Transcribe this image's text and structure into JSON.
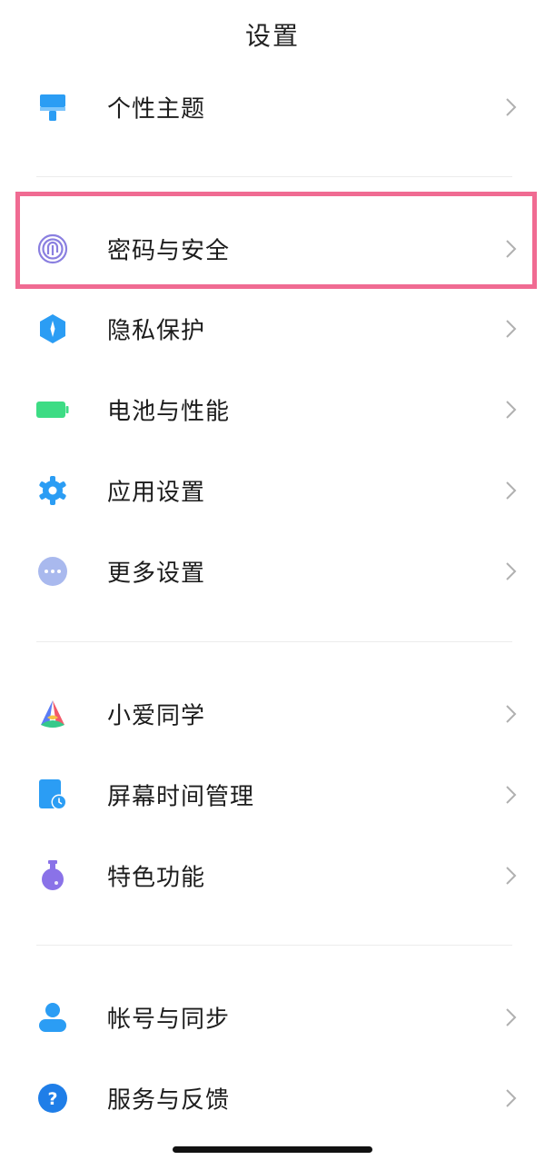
{
  "page": {
    "title": "设置"
  },
  "items": [
    {
      "key": "theme",
      "label": "个性主题",
      "icon": "paint-brush-icon"
    },
    {
      "key": "password",
      "label": "密码与安全",
      "icon": "fingerprint-icon"
    },
    {
      "key": "privacy",
      "label": "隐私保护",
      "icon": "privacy-shield-icon"
    },
    {
      "key": "battery",
      "label": "电池与性能",
      "icon": "battery-icon"
    },
    {
      "key": "apps",
      "label": "应用设置",
      "icon": "gear-icon"
    },
    {
      "key": "more",
      "label": "更多设置",
      "icon": "more-dots-icon"
    },
    {
      "key": "xiaoai",
      "label": "小爱同学",
      "icon": "xiaoai-icon"
    },
    {
      "key": "screentime",
      "label": "屏幕时间管理",
      "icon": "screen-time-icon"
    },
    {
      "key": "features",
      "label": "特色功能",
      "icon": "flask-icon"
    },
    {
      "key": "account",
      "label": "帐号与同步",
      "icon": "account-person-icon"
    },
    {
      "key": "feedback",
      "label": "服务与反馈",
      "icon": "help-question-icon"
    }
  ],
  "colors": {
    "highlight": "#f06b92",
    "blue": "#2196f3",
    "green": "#3ddc84",
    "purple": "#8a72e8",
    "chevron": "#b0b0b0"
  }
}
